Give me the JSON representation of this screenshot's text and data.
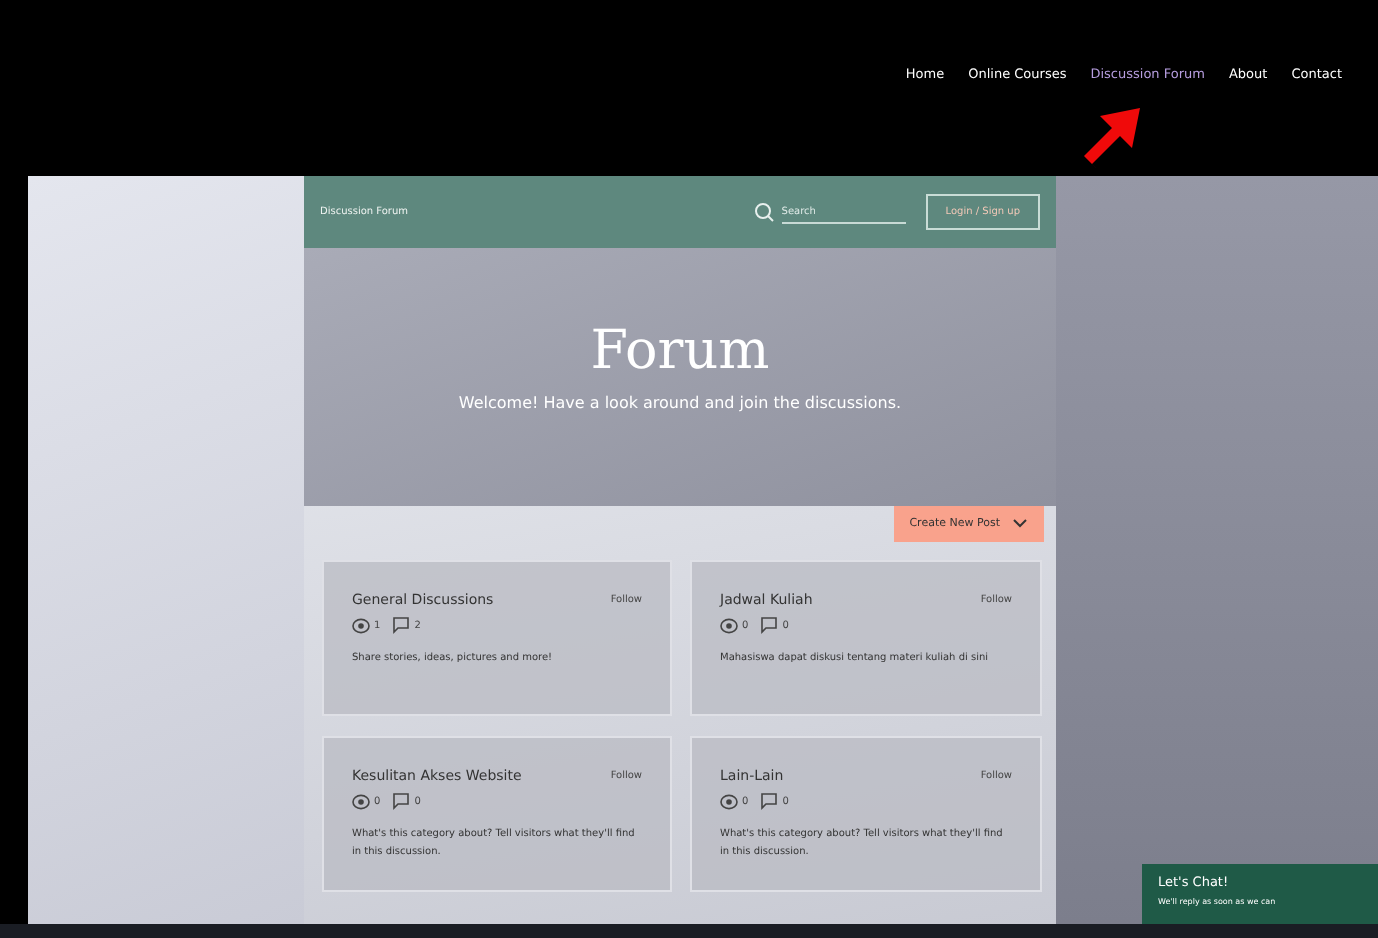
{
  "nav": {
    "items": [
      {
        "label": "Home",
        "selected": false
      },
      {
        "label": "Online Courses",
        "selected": false
      },
      {
        "label": "Discussion Forum",
        "selected": true
      },
      {
        "label": "About",
        "selected": false
      },
      {
        "label": "Contact",
        "selected": false
      }
    ]
  },
  "forum_header": {
    "title": "Discussion Forum",
    "search": {
      "placeholder": "Search"
    },
    "login": "Login / Sign up"
  },
  "hero": {
    "title": "Forum",
    "subtitle": "Welcome! Have a look around and join the discussions."
  },
  "create_button": "Create New Post",
  "categories": [
    {
      "name": "General Discussions",
      "follow": "Follow",
      "views": "1",
      "posts": "2",
      "description": "Share stories, ideas, pictures and more!"
    },
    {
      "name": "Jadwal Kuliah",
      "follow": "Follow",
      "views": "0",
      "posts": "0",
      "description": "Mahasiswa dapat diskusi tentang materi kuliah di sini"
    },
    {
      "name": "Kesulitan Akses Website",
      "follow": "Follow",
      "views": "0",
      "posts": "0",
      "description": "What's this category about? Tell visitors what they'll find in this discussion."
    },
    {
      "name": "Lain-Lain",
      "follow": "Follow",
      "views": "0",
      "posts": "0",
      "description": "What's this category about? Tell visitors what they'll find in this discussion."
    }
  ],
  "chat": {
    "title": "Let's Chat!",
    "subtitle": "We'll reply as soon as we can"
  }
}
